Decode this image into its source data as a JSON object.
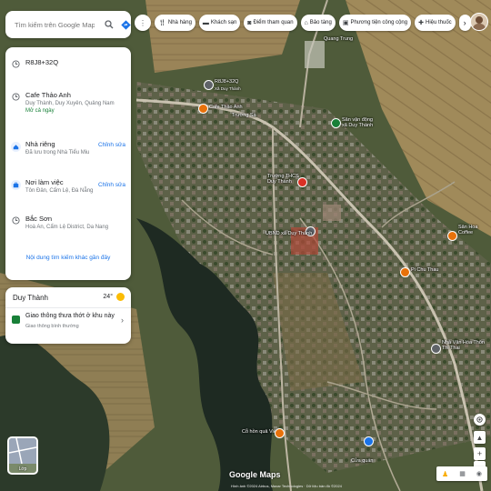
{
  "search": {
    "placeholder": "Tìm kiếm trên Google Maps"
  },
  "results": [
    {
      "title": "R8J8+32Q",
      "type": "pin"
    },
    {
      "title": "Cafe Thảo Anh",
      "line2": "Duy Thành, Duy Xuyên, Quảng Nam",
      "status": "Mở cả ngày",
      "type": "clock"
    },
    {
      "title": "Nhà riêng",
      "line2": "Đã lưu trong Nhà Tiểu Miu",
      "action": "Chỉnh sửa",
      "type": "home"
    },
    {
      "title": "Nơi làm việc",
      "line2": "Tôn Đản, Cẩm Lệ, Đà Nẵng",
      "action": "Chỉnh sửa",
      "type": "work"
    },
    {
      "title": "Bắc Sơn",
      "line2": "Hoà An, Cẩm Lệ District, Da Nang",
      "type": "clock"
    }
  ],
  "more_link": "Nội dung tìm kiếm khác gần đây",
  "weather": {
    "place": "Duy Thành",
    "temp": "24°",
    "traffic_title": "Giao thông thưa thớt ở khu này",
    "traffic_sub": "Giao thông bình thường"
  },
  "chips": [
    {
      "label": "Nhà hàng",
      "icon": "restaurant-icon"
    },
    {
      "label": "Khách sạn",
      "icon": "hotel-icon"
    },
    {
      "label": "Điểm tham quan",
      "icon": "camera-icon"
    },
    {
      "label": "Bảo tàng",
      "icon": "museum-icon"
    },
    {
      "label": "Phương tiện công cộng",
      "icon": "transit-icon"
    },
    {
      "label": "Hiệu thuốc",
      "icon": "pharmacy-icon"
    }
  ],
  "map_labels": {
    "quang_trung": "Quang Trung",
    "plus_code": "R8J8+32Q",
    "plus_code_sub": "Xã Duy Thành",
    "cafe": "Cafe Thảo Anh",
    "road": "Trường Sa",
    "field": "Sân vận động xã Duy Thành",
    "school": "Trường THCS Duy Thành",
    "ubnd": "UBND xã Duy Thành",
    "coffee": "Sân Hoa Coffee",
    "pichuthau": "Pi Chu Thau",
    "nhavan": "Nhà Văn Hóa Thôn Thi Thai",
    "chon": "Cỗ hồn quả Việt",
    "cuaquan": "Cửa quán"
  },
  "brand": "Google Maps",
  "layers_label": "Lớp",
  "footer": "Hình ảnh ©2024 Airbus, Maxar Technologies · Dữ liệu bản đồ ©2024",
  "colors": {
    "accent": "#1a73e8",
    "green": "#188038",
    "pin_orange": "#e8710a",
    "pin_red": "#d93025"
  }
}
